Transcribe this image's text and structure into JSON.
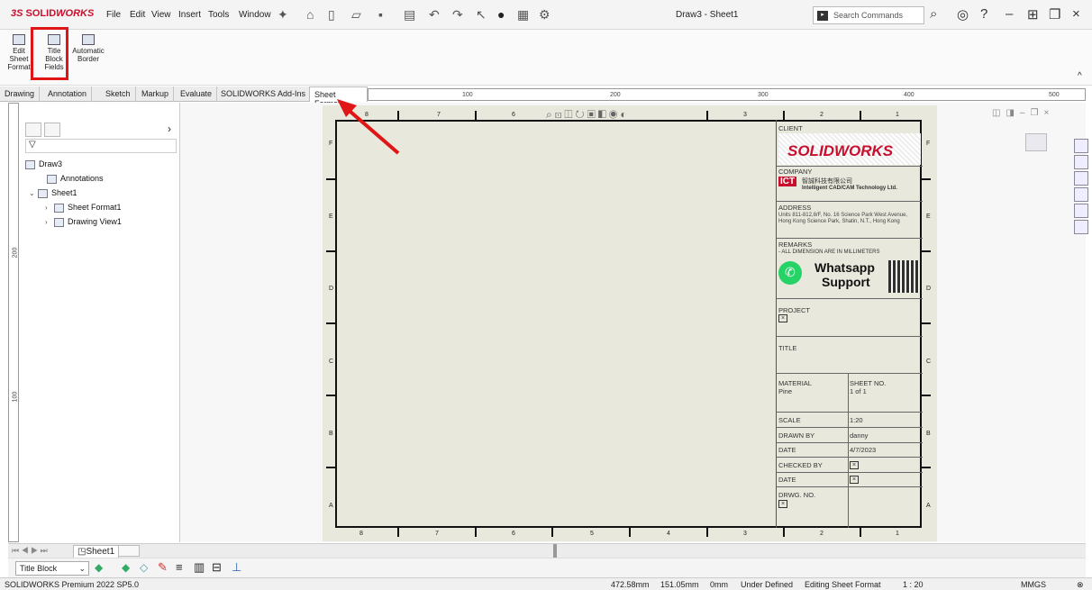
{
  "app": {
    "logo_prefix": "3S",
    "logo_bold": "SOLID",
    "logo_rest": "WORKS",
    "document_title": "Draw3 - Sheet1"
  },
  "menu": [
    "File",
    "Edit",
    "View",
    "Insert",
    "Tools",
    "Window"
  ],
  "search": {
    "placeholder": "Search Commands"
  },
  "command_manager": {
    "edit_sheet_format": "Edit Sheet Format",
    "title_block_fields": "Title Block Fields",
    "automatic_border": "Automatic Border"
  },
  "tabs": [
    "Drawing",
    "Annotation",
    "Sketch",
    "Markup",
    "Evaluate",
    "SOLIDWORKS Add-Ins",
    "Sheet Format"
  ],
  "active_tab": "Sheet Format",
  "ruler": {
    "h_labels": [
      "100",
      "200",
      "300",
      "400",
      "500"
    ],
    "v_labels": [
      "200",
      "100"
    ]
  },
  "tree": {
    "root": "Draw3",
    "items": [
      "Annotations",
      "Sheet1",
      "Sheet Format1",
      "Drawing View1"
    ]
  },
  "zones": {
    "columns": [
      "8",
      "7",
      "6",
      "5",
      "4",
      "3",
      "2",
      "1"
    ],
    "rows": [
      "F",
      "E",
      "D",
      "C",
      "B",
      "A"
    ]
  },
  "title_block": {
    "client_label": "CLIENT",
    "client_logo": "SOLIDWORKS",
    "company_label": "COMPANY",
    "company_logo": "ICT",
    "company_cn": "智誠科技有限公司",
    "company_en": "Intelligent CAD/CAM Technology Ltd.",
    "address_label": "ADDRESS",
    "address_text": "Units 811-812,8/F, No. 16 Science Park West Avenue, Hong Kong Science Park, Shatin, N.T., Hong Kong",
    "remarks_label": "REMARKS",
    "remarks_text": "- ALL DIMENSION ARE IN MILLIMETERS",
    "whatsapp_line1": "Whatsapp",
    "whatsapp_line2": "Support",
    "project_label": "PROJECT",
    "title_label": "TITLE",
    "material_label": "MATERIAL",
    "material_value": "Pine",
    "sheet_no_label": "SHEET NO.",
    "sheet_no_value": "1 of 1",
    "scale_label": "SCALE",
    "scale_value": "1:20",
    "drawn_by_label": "DRAWN BY",
    "drawn_by_value": "danny",
    "date_label": "DATE",
    "date_value": "4/7/2023",
    "checked_by_label": "CHECKED BY",
    "date2_label": "DATE",
    "drwg_no_label": "DRWG. NO."
  },
  "sheet_tab": "Sheet1",
  "bottom_toolbar": {
    "dropdown_value": "Title Block"
  },
  "status": {
    "product": "SOLIDWORKS Premium 2022 SP5.0",
    "x": "472.58mm",
    "y": "151.05mm",
    "z": "0mm",
    "state": "Under Defined",
    "mode": "Editing Sheet Format",
    "scale": "1 : 20",
    "units": "MMGS"
  },
  "colors": {
    "accent_red": "#e01616",
    "brand_red": "#c8102e",
    "sheet_bg": "#e8e8dc",
    "whatsapp_green": "#25d366"
  }
}
